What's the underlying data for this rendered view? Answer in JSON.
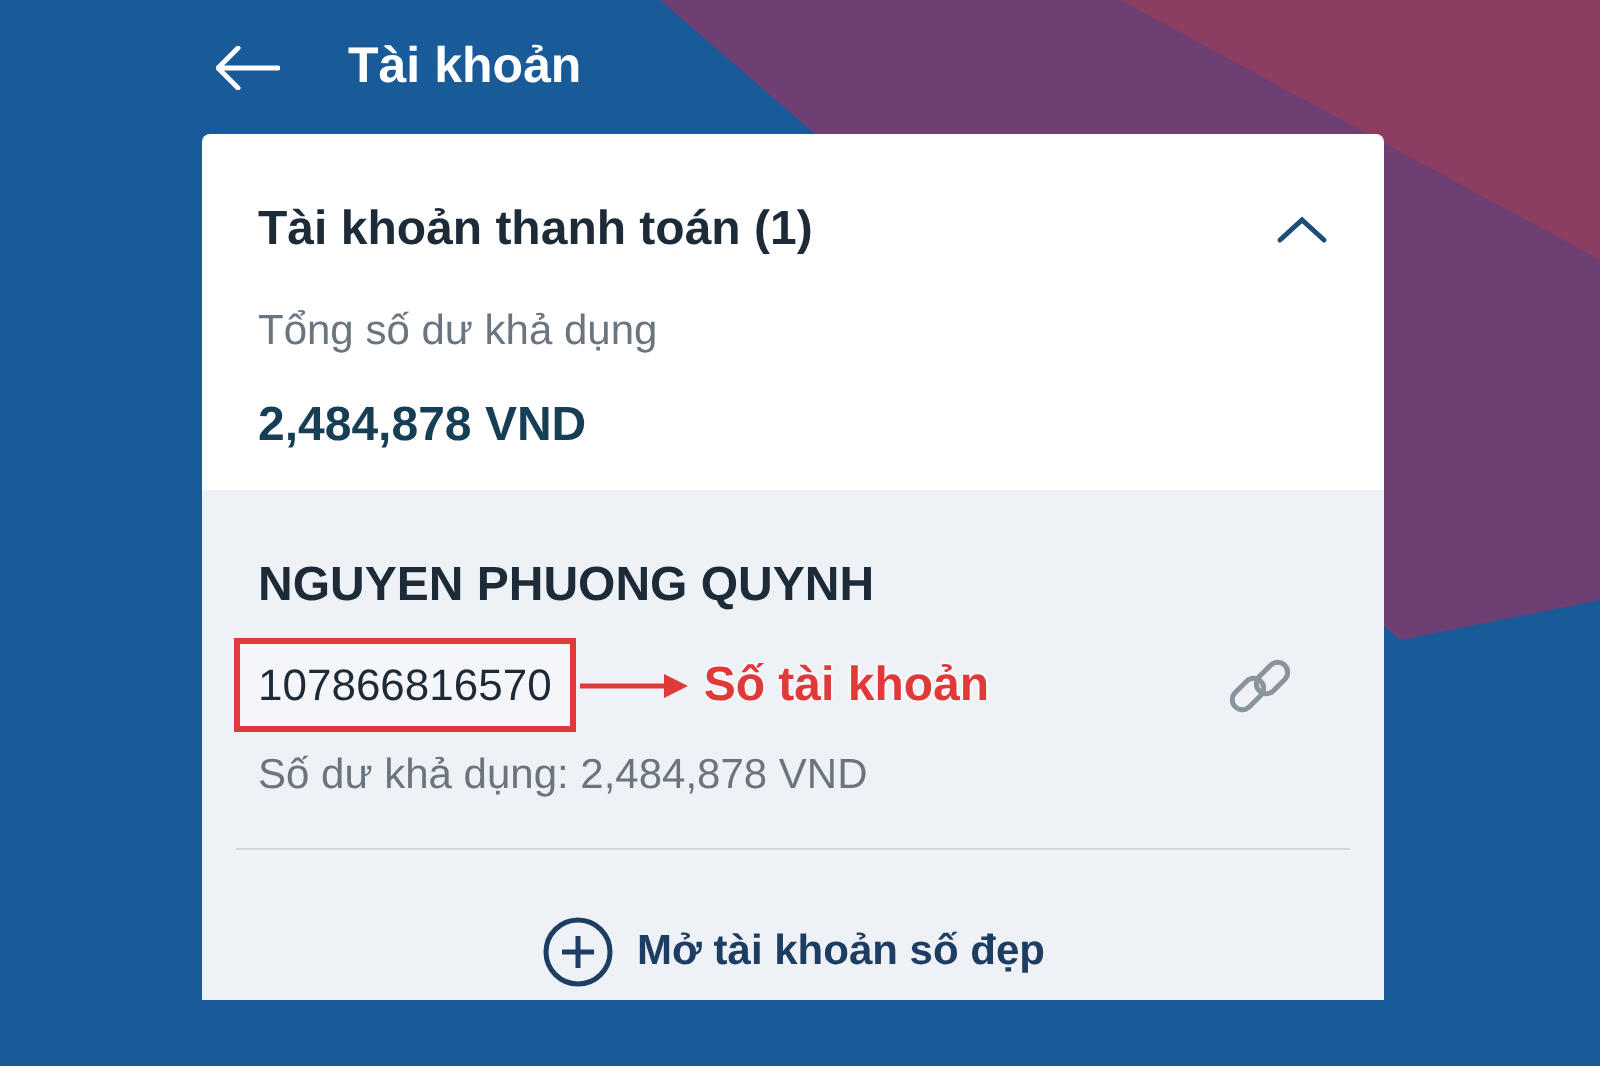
{
  "header": {
    "title": "Tài khoản"
  },
  "account_group": {
    "title": "Tài khoản thanh toán (1)",
    "expanded": true,
    "balance_label": "Tổng số dư khả dụng",
    "balance": "2,484,878 VND"
  },
  "accounts": [
    {
      "holder": "NGUYEN PHUONG QUYNH",
      "number": "107866816570",
      "balance_text": "Số dư khả dụng: 2,484,878 VND"
    }
  ],
  "annotation": {
    "label": "Số tài khoản"
  },
  "open_account_button": {
    "label": "Mở tài khoản số đẹp"
  }
}
